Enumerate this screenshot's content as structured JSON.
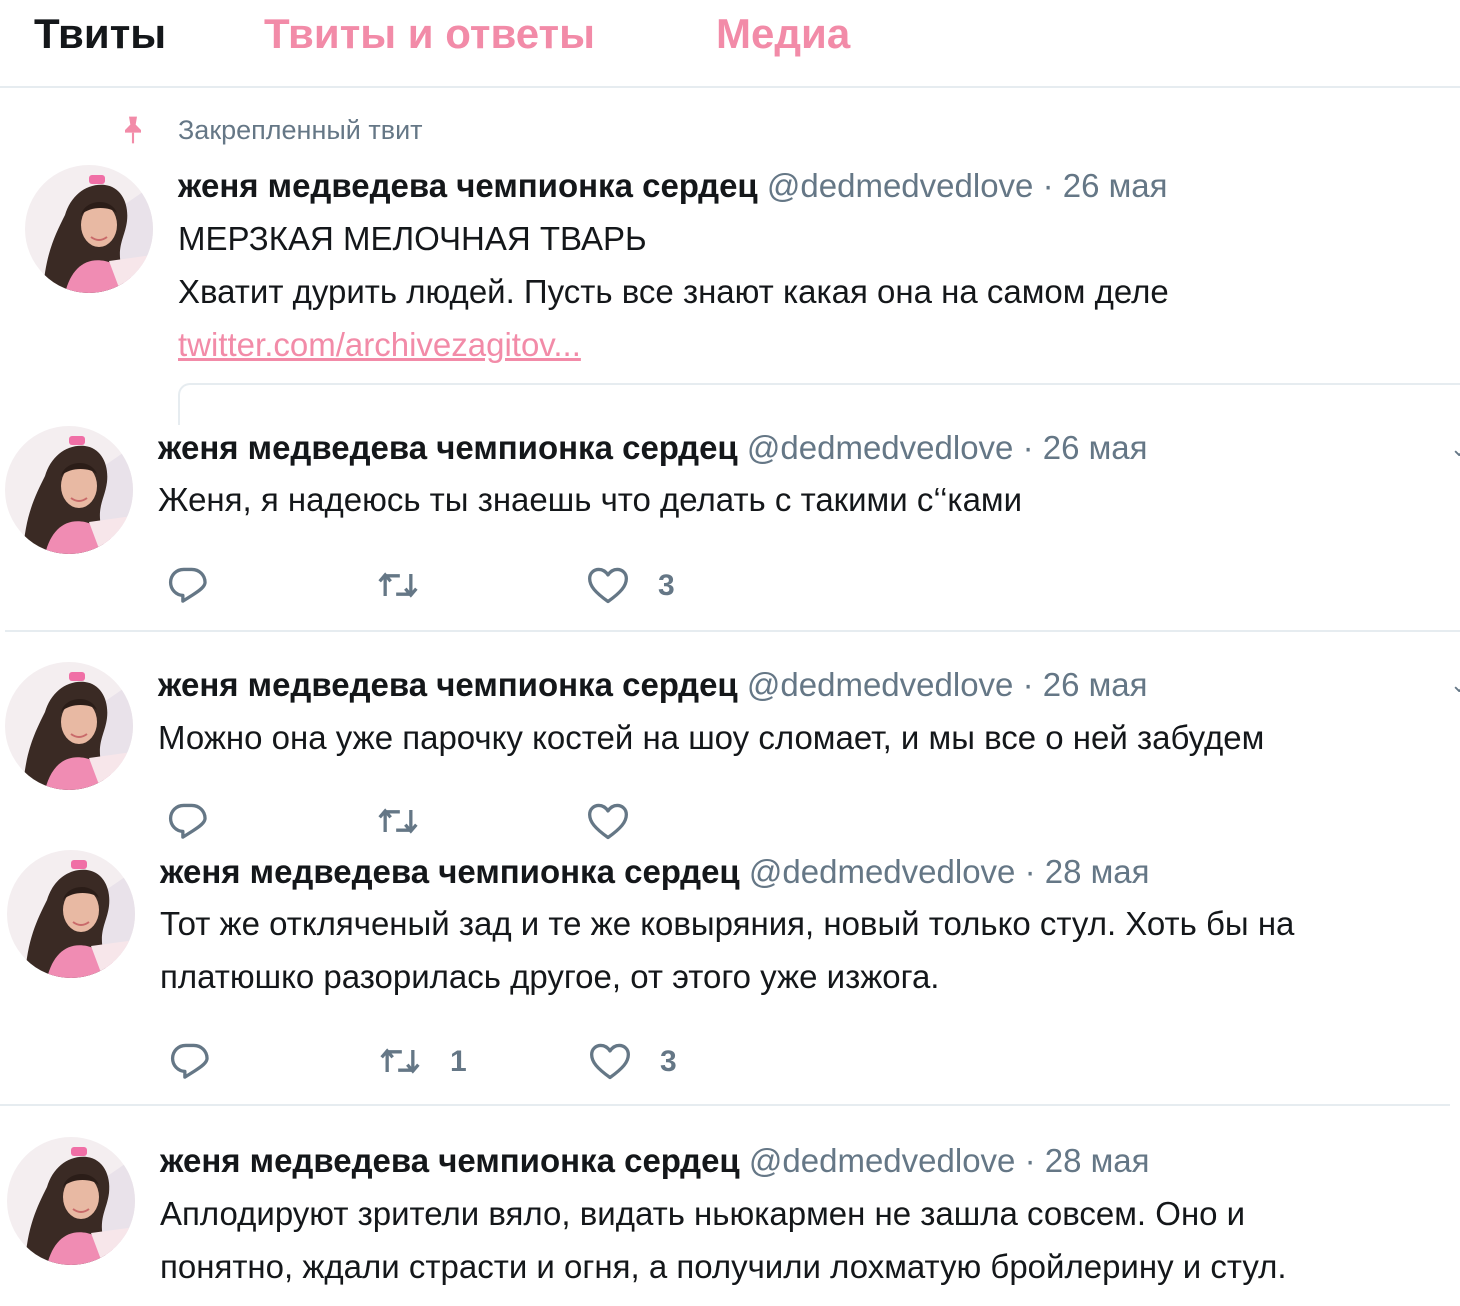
{
  "tabs": {
    "tweets": "Твиты",
    "tweets_and_replies": "Твиты и ответы",
    "media": "Медиа"
  },
  "pinned": {
    "label": "Закрепленный твит",
    "name": "женя медведева чемпионка сердец",
    "handle": "@dedmedvedlove",
    "date": "26 мая",
    "line1": "МЕРЗКАЯ МЕЛОЧНАЯ ТВАРЬ",
    "line2": "Хватит дурить людей. Пусть все знают какая она на самом деле",
    "link": "twitter.com/archivezagitov..."
  },
  "separator": "·",
  "tweets": [
    {
      "name": "женя медведева чемпионка сердец",
      "handle": "@dedmedvedlove",
      "date": "26 мая",
      "lines": [
        "Женя, я надеюсь ты знаешь что делать с такими с‘‘ками"
      ],
      "retweets": "",
      "likes": "3"
    },
    {
      "name": "женя медведева чемпионка сердец",
      "handle": "@dedmedvedlove",
      "date": "26 мая",
      "lines": [
        "Можно она уже парочку костей на шоу сломает, и мы все о ней забудем"
      ],
      "retweets": "",
      "likes": ""
    },
    {
      "name": "женя медведева чемпионка сердец",
      "handle": "@dedmedvedlove",
      "date": "28 мая",
      "lines": [
        "Тот же отклячeный зад и те же ковыряния, новый только стул. Хоть бы на",
        "платюшко разорилась другое, от этого уже изжога."
      ],
      "retweets": "1",
      "likes": "3"
    },
    {
      "name": "женя медведева чемпионка сердец",
      "handle": "@dedmedvedlove",
      "date": "28 мая",
      "lines": [
        "Аплодируют зрители вяло, видать ньюкармен не зашла совсем. Оно и",
        "понятно, ждали страсти и огня, а получили лохматую бройлерину и стул."
      ],
      "retweets": "",
      "likes": ""
    }
  ],
  "icons": {
    "reply": "reply-icon",
    "retweet": "retweet-icon",
    "like": "heart-icon",
    "pin": "pin-icon",
    "caret": "chevron-down-icon"
  },
  "colors": {
    "accent": "#f28ba8",
    "text": "#14171a",
    "secondary": "#657786",
    "border": "#e6ecf0"
  }
}
